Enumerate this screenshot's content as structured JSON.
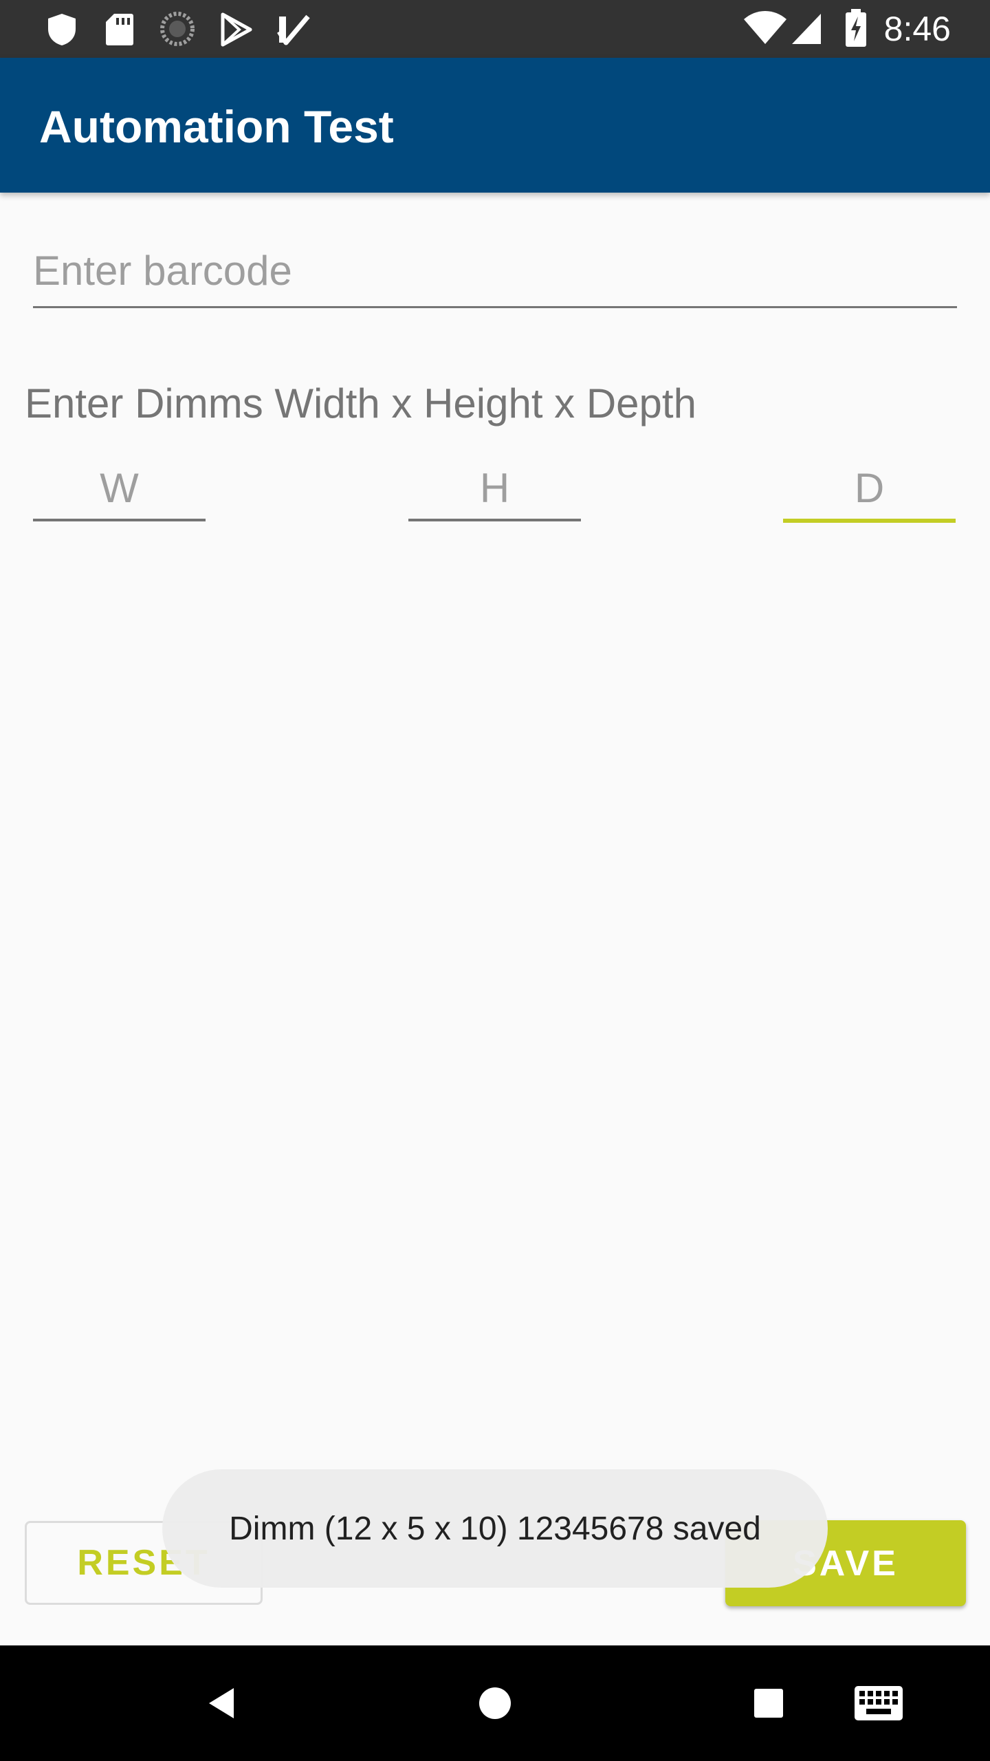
{
  "status_bar": {
    "time": "8:46",
    "left_icons": [
      "shield-icon",
      "sd-card-icon",
      "sync-circle-icon",
      "play-store-icon",
      "task-check-icon"
    ],
    "right_icons": [
      "wifi-icon",
      "signal-icon",
      "battery-charging-icon"
    ]
  },
  "app_bar": {
    "title": "Automation Test"
  },
  "form": {
    "barcode": {
      "value": "",
      "placeholder": "Enter barcode"
    },
    "dimms_label": "Enter Dimms Width x Height x Depth",
    "width": {
      "value": "",
      "placeholder": "W"
    },
    "height": {
      "value": "",
      "placeholder": "H"
    },
    "depth": {
      "value": "",
      "placeholder": "D"
    }
  },
  "actions": {
    "reset_label": "RESET",
    "save_label": "SAVE"
  },
  "toast": {
    "message": "Dimm (12 x 5 x 10) 12345678 saved"
  },
  "nav_bar": {
    "buttons": [
      "back-icon",
      "home-icon",
      "recents-icon",
      "keyboard-icon"
    ]
  },
  "colors": {
    "status_bar": "#333333",
    "app_bar": "#01487c",
    "accent": "#c3cd24",
    "background": "#fafafa",
    "nav_bar": "#000000"
  }
}
